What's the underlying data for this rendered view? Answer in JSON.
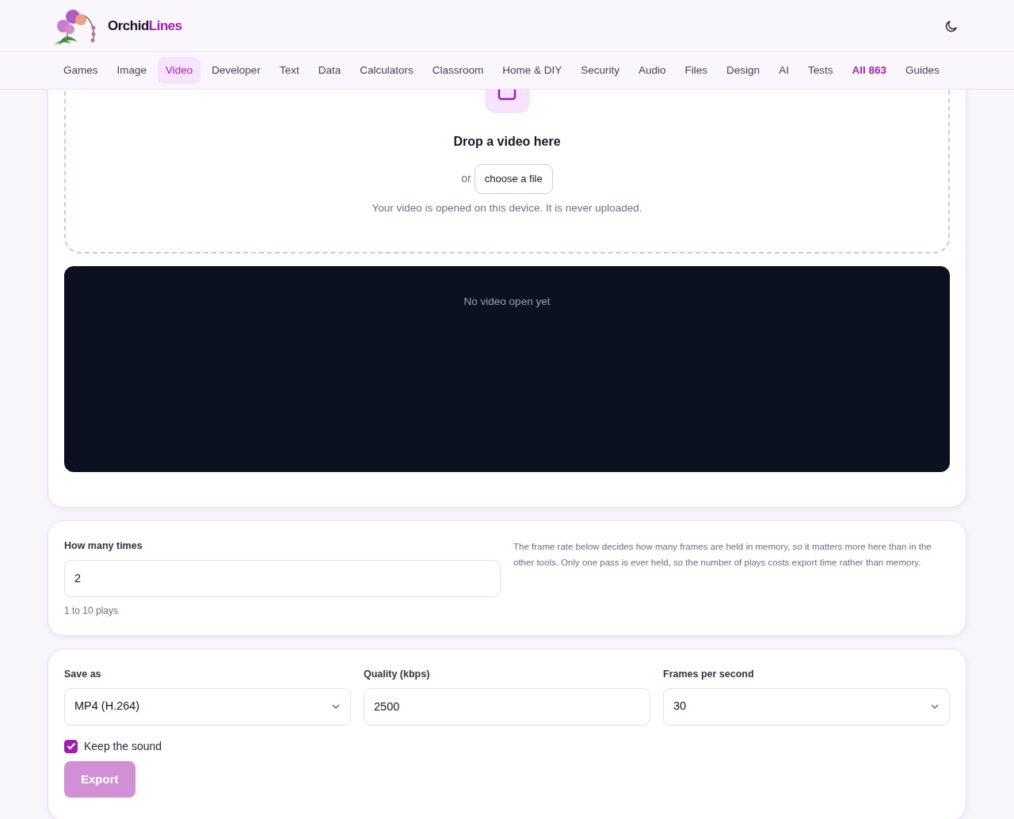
{
  "brand": {
    "name_start": "Orchid",
    "name_end": "Lines"
  },
  "nav": [
    {
      "label": "Games",
      "selected": false,
      "highlighted": false
    },
    {
      "label": "Image",
      "selected": false,
      "highlighted": false
    },
    {
      "label": "Video",
      "selected": true,
      "highlighted": false
    },
    {
      "label": "Developer",
      "selected": false,
      "highlighted": false
    },
    {
      "label": "Text",
      "selected": false,
      "highlighted": false
    },
    {
      "label": "Data",
      "selected": false,
      "highlighted": false
    },
    {
      "label": "Calculators",
      "selected": false,
      "highlighted": false
    },
    {
      "label": "Classroom",
      "selected": false,
      "highlighted": false
    },
    {
      "label": "Home & DIY",
      "selected": false,
      "highlighted": false
    },
    {
      "label": "Security",
      "selected": false,
      "highlighted": false
    },
    {
      "label": "Audio",
      "selected": false,
      "highlighted": false
    },
    {
      "label": "Files",
      "selected": false,
      "highlighted": false
    },
    {
      "label": "Design",
      "selected": false,
      "highlighted": false
    },
    {
      "label": "AI",
      "selected": false,
      "highlighted": false
    },
    {
      "label": "Tests",
      "selected": false,
      "highlighted": false
    },
    {
      "label": "All 863",
      "selected": false,
      "highlighted": true
    },
    {
      "label": "Guides",
      "selected": false,
      "highlighted": false
    }
  ],
  "dropzone": {
    "title": "Drop a video here",
    "or": "or",
    "button": "choose a file",
    "note": "Your video is opened on this device. It is never uploaded."
  },
  "player": {
    "message": "No video open yet"
  },
  "repeat": {
    "label": "How many times",
    "value": "2",
    "hint": "1 to 10 plays",
    "info": "The frame rate below decides how many frames are held in memory, so it matters more here than in the other tools. Only one pass is ever held, so the number of plays costs export time rather than memory."
  },
  "export": {
    "fields": [
      {
        "kind": "select",
        "label": "Save as",
        "value": "MP4 (H.264)"
      },
      {
        "kind": "input",
        "label": "Quality (kbps)",
        "value": "2500"
      },
      {
        "kind": "select",
        "label": "Frames per second",
        "value": "30"
      }
    ],
    "keep_sound": {
      "label": "Keep the sound",
      "checked": true
    },
    "button": {
      "label": "Export",
      "disabled": true
    }
  }
}
